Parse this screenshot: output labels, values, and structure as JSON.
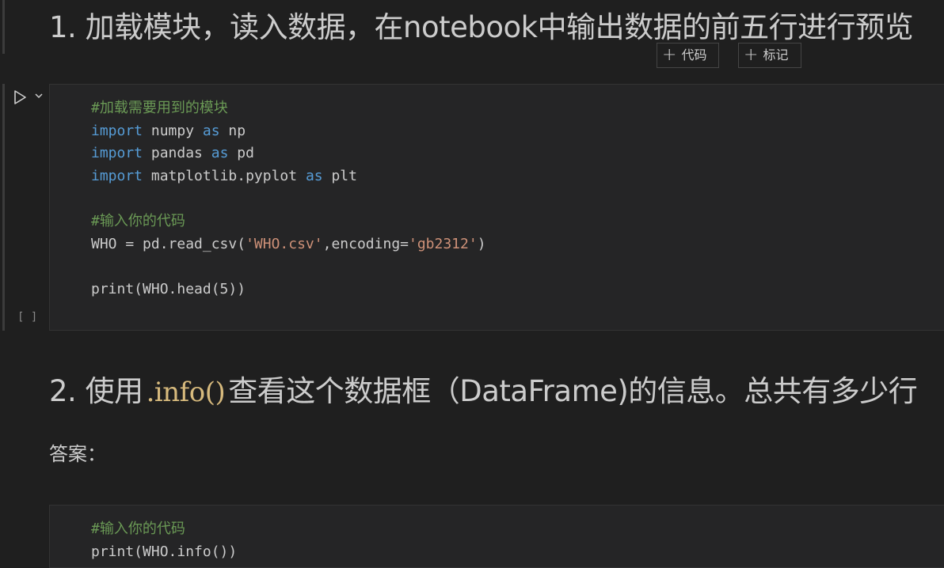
{
  "markdown1": {
    "heading": "1. 加载模块，读入数据，在notebook中输出数据的前五行进行预览"
  },
  "toolbar": {
    "add_code_label": "代码",
    "add_markdown_label": "标记"
  },
  "cell1": {
    "execution_count": "[ ]",
    "lines": [
      [
        {
          "t": "cm",
          "v": "#加载需要用到的模块"
        }
      ],
      [
        {
          "t": "kw",
          "v": "import"
        },
        {
          "t": "fn",
          "v": " numpy "
        },
        {
          "t": "kw",
          "v": "as"
        },
        {
          "t": "fn",
          "v": " np"
        }
      ],
      [
        {
          "t": "kw",
          "v": "import"
        },
        {
          "t": "fn",
          "v": " pandas "
        },
        {
          "t": "kw",
          "v": "as"
        },
        {
          "t": "fn",
          "v": " pd"
        }
      ],
      [
        {
          "t": "kw",
          "v": "import"
        },
        {
          "t": "fn",
          "v": " matplotlib.pyplot "
        },
        {
          "t": "kw",
          "v": "as"
        },
        {
          "t": "fn",
          "v": " plt"
        }
      ],
      [],
      [
        {
          "t": "cm",
          "v": "#输入你的代码"
        }
      ],
      [
        {
          "t": "fn",
          "v": "WHO = pd.read_csv("
        },
        {
          "t": "st",
          "v": "'WHO.csv'"
        },
        {
          "t": "fn",
          "v": ",encoding="
        },
        {
          "t": "st",
          "v": "'gb2312'"
        },
        {
          "t": "fn",
          "v": ")"
        }
      ],
      [],
      [
        {
          "t": "fn",
          "v": "print(WHO.head(5))"
        }
      ]
    ]
  },
  "markdown2": {
    "heading_prefix": "2. 使用",
    "inline_code": ".info()",
    "heading_suffix": "查看这个数据框（DataFrame)的信息。总共有多少行",
    "answer_label": "答案："
  },
  "cell2": {
    "lines": [
      [
        {
          "t": "cm",
          "v": "#输入你的代码"
        }
      ],
      [
        {
          "t": "fn",
          "v": "print(WHO.info())"
        }
      ]
    ]
  }
}
